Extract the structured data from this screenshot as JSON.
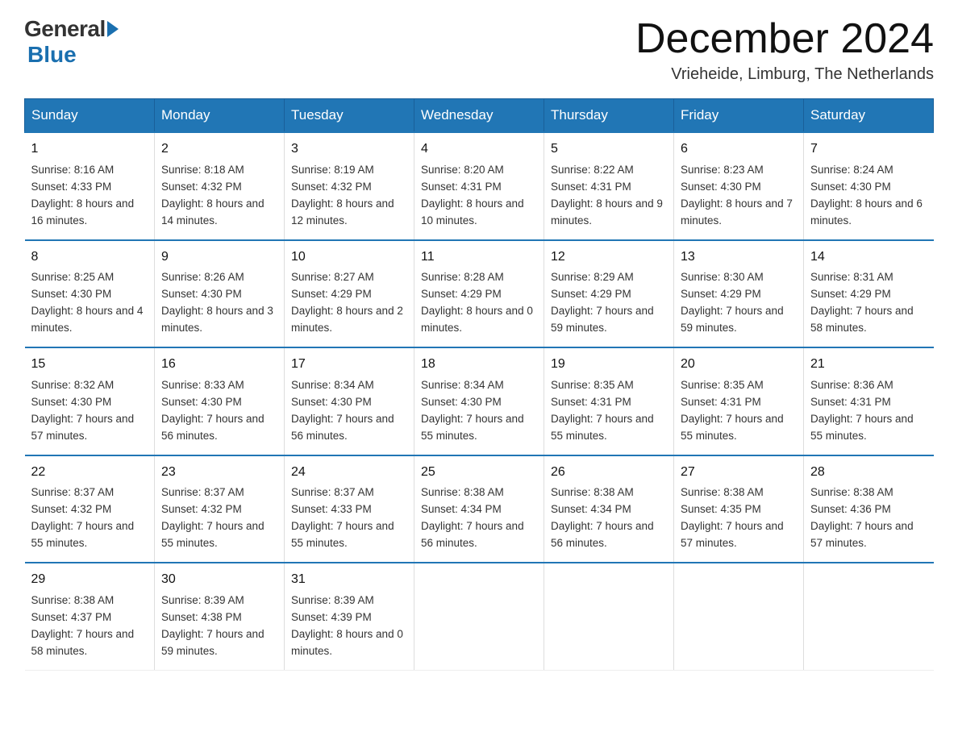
{
  "logo": {
    "general": "General",
    "blue": "Blue"
  },
  "title": "December 2024",
  "location": "Vrieheide, Limburg, The Netherlands",
  "days_of_week": [
    "Sunday",
    "Monday",
    "Tuesday",
    "Wednesday",
    "Thursday",
    "Friday",
    "Saturday"
  ],
  "weeks": [
    [
      {
        "day": "1",
        "sunrise": "8:16 AM",
        "sunset": "4:33 PM",
        "daylight": "8 hours and 16 minutes."
      },
      {
        "day": "2",
        "sunrise": "8:18 AM",
        "sunset": "4:32 PM",
        "daylight": "8 hours and 14 minutes."
      },
      {
        "day": "3",
        "sunrise": "8:19 AM",
        "sunset": "4:32 PM",
        "daylight": "8 hours and 12 minutes."
      },
      {
        "day": "4",
        "sunrise": "8:20 AM",
        "sunset": "4:31 PM",
        "daylight": "8 hours and 10 minutes."
      },
      {
        "day": "5",
        "sunrise": "8:22 AM",
        "sunset": "4:31 PM",
        "daylight": "8 hours and 9 minutes."
      },
      {
        "day": "6",
        "sunrise": "8:23 AM",
        "sunset": "4:30 PM",
        "daylight": "8 hours and 7 minutes."
      },
      {
        "day": "7",
        "sunrise": "8:24 AM",
        "sunset": "4:30 PM",
        "daylight": "8 hours and 6 minutes."
      }
    ],
    [
      {
        "day": "8",
        "sunrise": "8:25 AM",
        "sunset": "4:30 PM",
        "daylight": "8 hours and 4 minutes."
      },
      {
        "day": "9",
        "sunrise": "8:26 AM",
        "sunset": "4:30 PM",
        "daylight": "8 hours and 3 minutes."
      },
      {
        "day": "10",
        "sunrise": "8:27 AM",
        "sunset": "4:29 PM",
        "daylight": "8 hours and 2 minutes."
      },
      {
        "day": "11",
        "sunrise": "8:28 AM",
        "sunset": "4:29 PM",
        "daylight": "8 hours and 0 minutes."
      },
      {
        "day": "12",
        "sunrise": "8:29 AM",
        "sunset": "4:29 PM",
        "daylight": "7 hours and 59 minutes."
      },
      {
        "day": "13",
        "sunrise": "8:30 AM",
        "sunset": "4:29 PM",
        "daylight": "7 hours and 59 minutes."
      },
      {
        "day": "14",
        "sunrise": "8:31 AM",
        "sunset": "4:29 PM",
        "daylight": "7 hours and 58 minutes."
      }
    ],
    [
      {
        "day": "15",
        "sunrise": "8:32 AM",
        "sunset": "4:30 PM",
        "daylight": "7 hours and 57 minutes."
      },
      {
        "day": "16",
        "sunrise": "8:33 AM",
        "sunset": "4:30 PM",
        "daylight": "7 hours and 56 minutes."
      },
      {
        "day": "17",
        "sunrise": "8:34 AM",
        "sunset": "4:30 PM",
        "daylight": "7 hours and 56 minutes."
      },
      {
        "day": "18",
        "sunrise": "8:34 AM",
        "sunset": "4:30 PM",
        "daylight": "7 hours and 55 minutes."
      },
      {
        "day": "19",
        "sunrise": "8:35 AM",
        "sunset": "4:31 PM",
        "daylight": "7 hours and 55 minutes."
      },
      {
        "day": "20",
        "sunrise": "8:35 AM",
        "sunset": "4:31 PM",
        "daylight": "7 hours and 55 minutes."
      },
      {
        "day": "21",
        "sunrise": "8:36 AM",
        "sunset": "4:31 PM",
        "daylight": "7 hours and 55 minutes."
      }
    ],
    [
      {
        "day": "22",
        "sunrise": "8:37 AM",
        "sunset": "4:32 PM",
        "daylight": "7 hours and 55 minutes."
      },
      {
        "day": "23",
        "sunrise": "8:37 AM",
        "sunset": "4:32 PM",
        "daylight": "7 hours and 55 minutes."
      },
      {
        "day": "24",
        "sunrise": "8:37 AM",
        "sunset": "4:33 PM",
        "daylight": "7 hours and 55 minutes."
      },
      {
        "day": "25",
        "sunrise": "8:38 AM",
        "sunset": "4:34 PM",
        "daylight": "7 hours and 56 minutes."
      },
      {
        "day": "26",
        "sunrise": "8:38 AM",
        "sunset": "4:34 PM",
        "daylight": "7 hours and 56 minutes."
      },
      {
        "day": "27",
        "sunrise": "8:38 AM",
        "sunset": "4:35 PM",
        "daylight": "7 hours and 57 minutes."
      },
      {
        "day": "28",
        "sunrise": "8:38 AM",
        "sunset": "4:36 PM",
        "daylight": "7 hours and 57 minutes."
      }
    ],
    [
      {
        "day": "29",
        "sunrise": "8:38 AM",
        "sunset": "4:37 PM",
        "daylight": "7 hours and 58 minutes."
      },
      {
        "day": "30",
        "sunrise": "8:39 AM",
        "sunset": "4:38 PM",
        "daylight": "7 hours and 59 minutes."
      },
      {
        "day": "31",
        "sunrise": "8:39 AM",
        "sunset": "4:39 PM",
        "daylight": "8 hours and 0 minutes."
      },
      null,
      null,
      null,
      null
    ]
  ]
}
